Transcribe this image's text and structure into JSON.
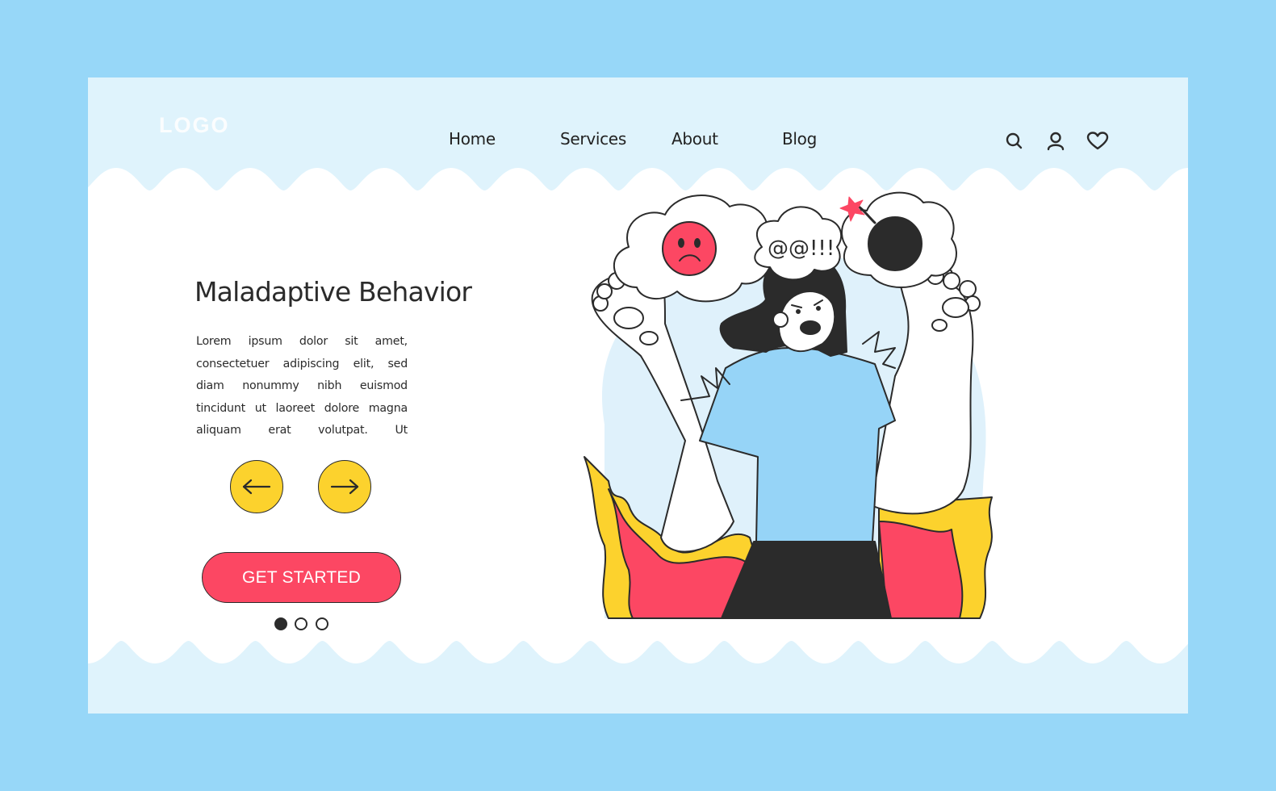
{
  "header": {
    "logo": "LOGO",
    "nav": [
      {
        "label": "Home"
      },
      {
        "label": "Services"
      },
      {
        "label": "About"
      },
      {
        "label": "Blog"
      }
    ],
    "icons": [
      "search-icon",
      "user-icon",
      "heart-icon"
    ]
  },
  "hero": {
    "title": "Maladaptive Behavior",
    "body": "Lorem ipsum dolor sit amet, consectetuer adipiscing elit, sed diam nonummy nibh euismod tincidunt ut laoreet dolore magna aliquam erat volutpat. Ut",
    "prev_icon": "arrow-left-icon",
    "next_icon": "arrow-right-icon",
    "cta_label": "GET STARTED",
    "pagination": {
      "total": 3,
      "active": 1
    }
  },
  "illustration": {
    "speech_text": "@@!!!",
    "description": "Angry woman with thought bubbles (sad face, swearing, bomb) surrounded by flames"
  },
  "colors": {
    "background": "#97d7f8",
    "band": "#dff3fc",
    "accent_red": "#fc4763",
    "accent_yellow": "#fcd22d",
    "shirt_blue": "#96d4f7",
    "dark": "#2b2b2b"
  }
}
